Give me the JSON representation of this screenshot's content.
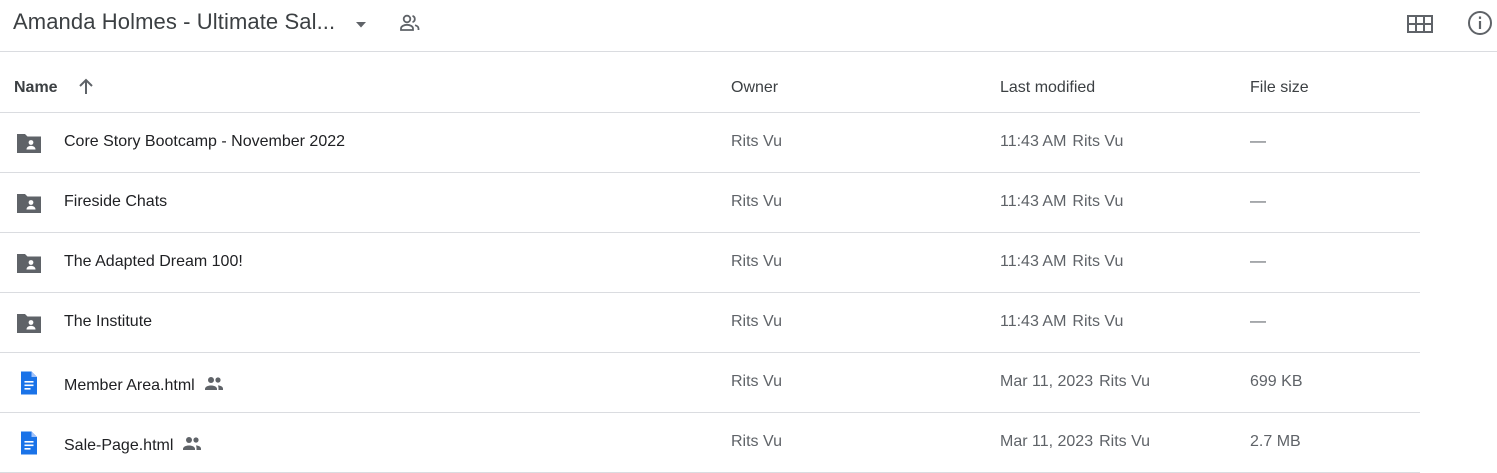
{
  "folder_title": "Amanda Holmes - Ultimate Sal...",
  "columns": {
    "name": "Name",
    "owner": "Owner",
    "last_modified": "Last modified",
    "file_size": "File size"
  },
  "rows": [
    {
      "type": "shared-folder",
      "name": "Core Story Bootcamp - November 2022",
      "owner": "Rits Vu",
      "modified": "11:43 AM",
      "modified_by": "Rits Vu",
      "size": "—",
      "shared": false
    },
    {
      "type": "shared-folder",
      "name": "Fireside Chats",
      "owner": "Rits Vu",
      "modified": "11:43 AM",
      "modified_by": "Rits Vu",
      "size": "—",
      "shared": false
    },
    {
      "type": "shared-folder",
      "name": "The Adapted Dream 100!",
      "owner": "Rits Vu",
      "modified": "11:43 AM",
      "modified_by": "Rits Vu",
      "size": "—",
      "shared": false
    },
    {
      "type": "shared-folder",
      "name": "The Institute",
      "owner": "Rits Vu",
      "modified": "11:43 AM",
      "modified_by": "Rits Vu",
      "size": "—",
      "shared": false
    },
    {
      "type": "doc",
      "name": "Member Area.html",
      "owner": "Rits Vu",
      "modified": "Mar 11, 2023",
      "modified_by": "Rits Vu",
      "size": "699 KB",
      "shared": true
    },
    {
      "type": "doc",
      "name": "Sale-Page.html",
      "owner": "Rits Vu",
      "modified": "Mar 11, 2023",
      "modified_by": "Rits Vu",
      "size": "2.7 MB",
      "shared": true
    }
  ],
  "colors": {
    "doc_icon": "#1a73e8",
    "folder_icon": "#5f6368",
    "divider": "#dadce0"
  }
}
